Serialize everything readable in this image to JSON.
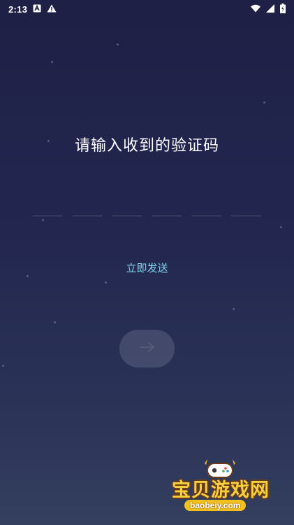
{
  "status_bar": {
    "time": "2:13",
    "icons": [
      "a-notification-icon",
      "warning-icon",
      "wifi-icon",
      "signal-icon",
      "battery-icon"
    ]
  },
  "screen": {
    "title": "请输入收到的验证码",
    "code_length": 6,
    "send_label": "立即发送",
    "next_icon": "arrow-right-icon"
  },
  "watermark": {
    "brand": "宝贝游戏网",
    "url": "baobeiy.com"
  },
  "colors": {
    "background_top": "#1e2045",
    "background_bottom": "#343f5f",
    "link": "#7fd3e6",
    "brand_yellow": "#f4d13d"
  }
}
